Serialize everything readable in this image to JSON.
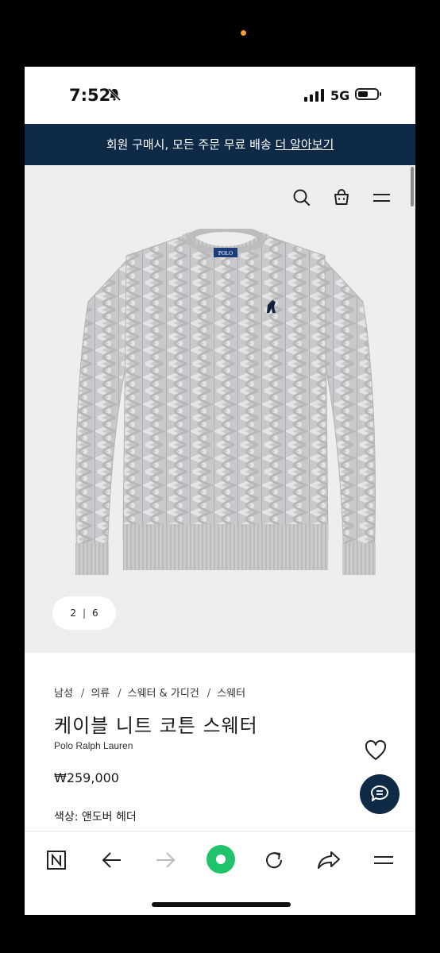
{
  "status_bar": {
    "time": "7:52",
    "network": "5G"
  },
  "banner": {
    "text": "회원 구매시, 모든 주문 무료 배송 ",
    "link": "더 알아보기"
  },
  "gallery": {
    "current": "2",
    "separator": "|",
    "total": "6"
  },
  "product": {
    "breadcrumb": [
      "남성",
      "의류",
      "스웨터 & 가디건",
      "스웨터"
    ],
    "breadcrumb_separator": "/",
    "title": "케이블 니트 코튼 스웨터",
    "brand": "Polo Ralph Lauren",
    "price": "₩259,000",
    "color": "색상: 앤도버 헤더",
    "logo_text": "POLO"
  },
  "icons": {
    "header": [
      "search-icon",
      "shopping-bag-icon",
      "menu-icon"
    ],
    "toolbar": [
      "naver-n-icon",
      "back-arrow-icon",
      "forward-arrow-icon",
      "green-home-icon",
      "refresh-icon",
      "share-icon",
      "menu-icon"
    ],
    "other": [
      "heart-icon",
      "chat-icon",
      "bell-muted-icon",
      "signal-icon",
      "battery-icon"
    ]
  },
  "colors": {
    "banner_bg": "#0e2a47",
    "accent_green": "#1fc36b",
    "hero_bg": "#eeeeee"
  }
}
